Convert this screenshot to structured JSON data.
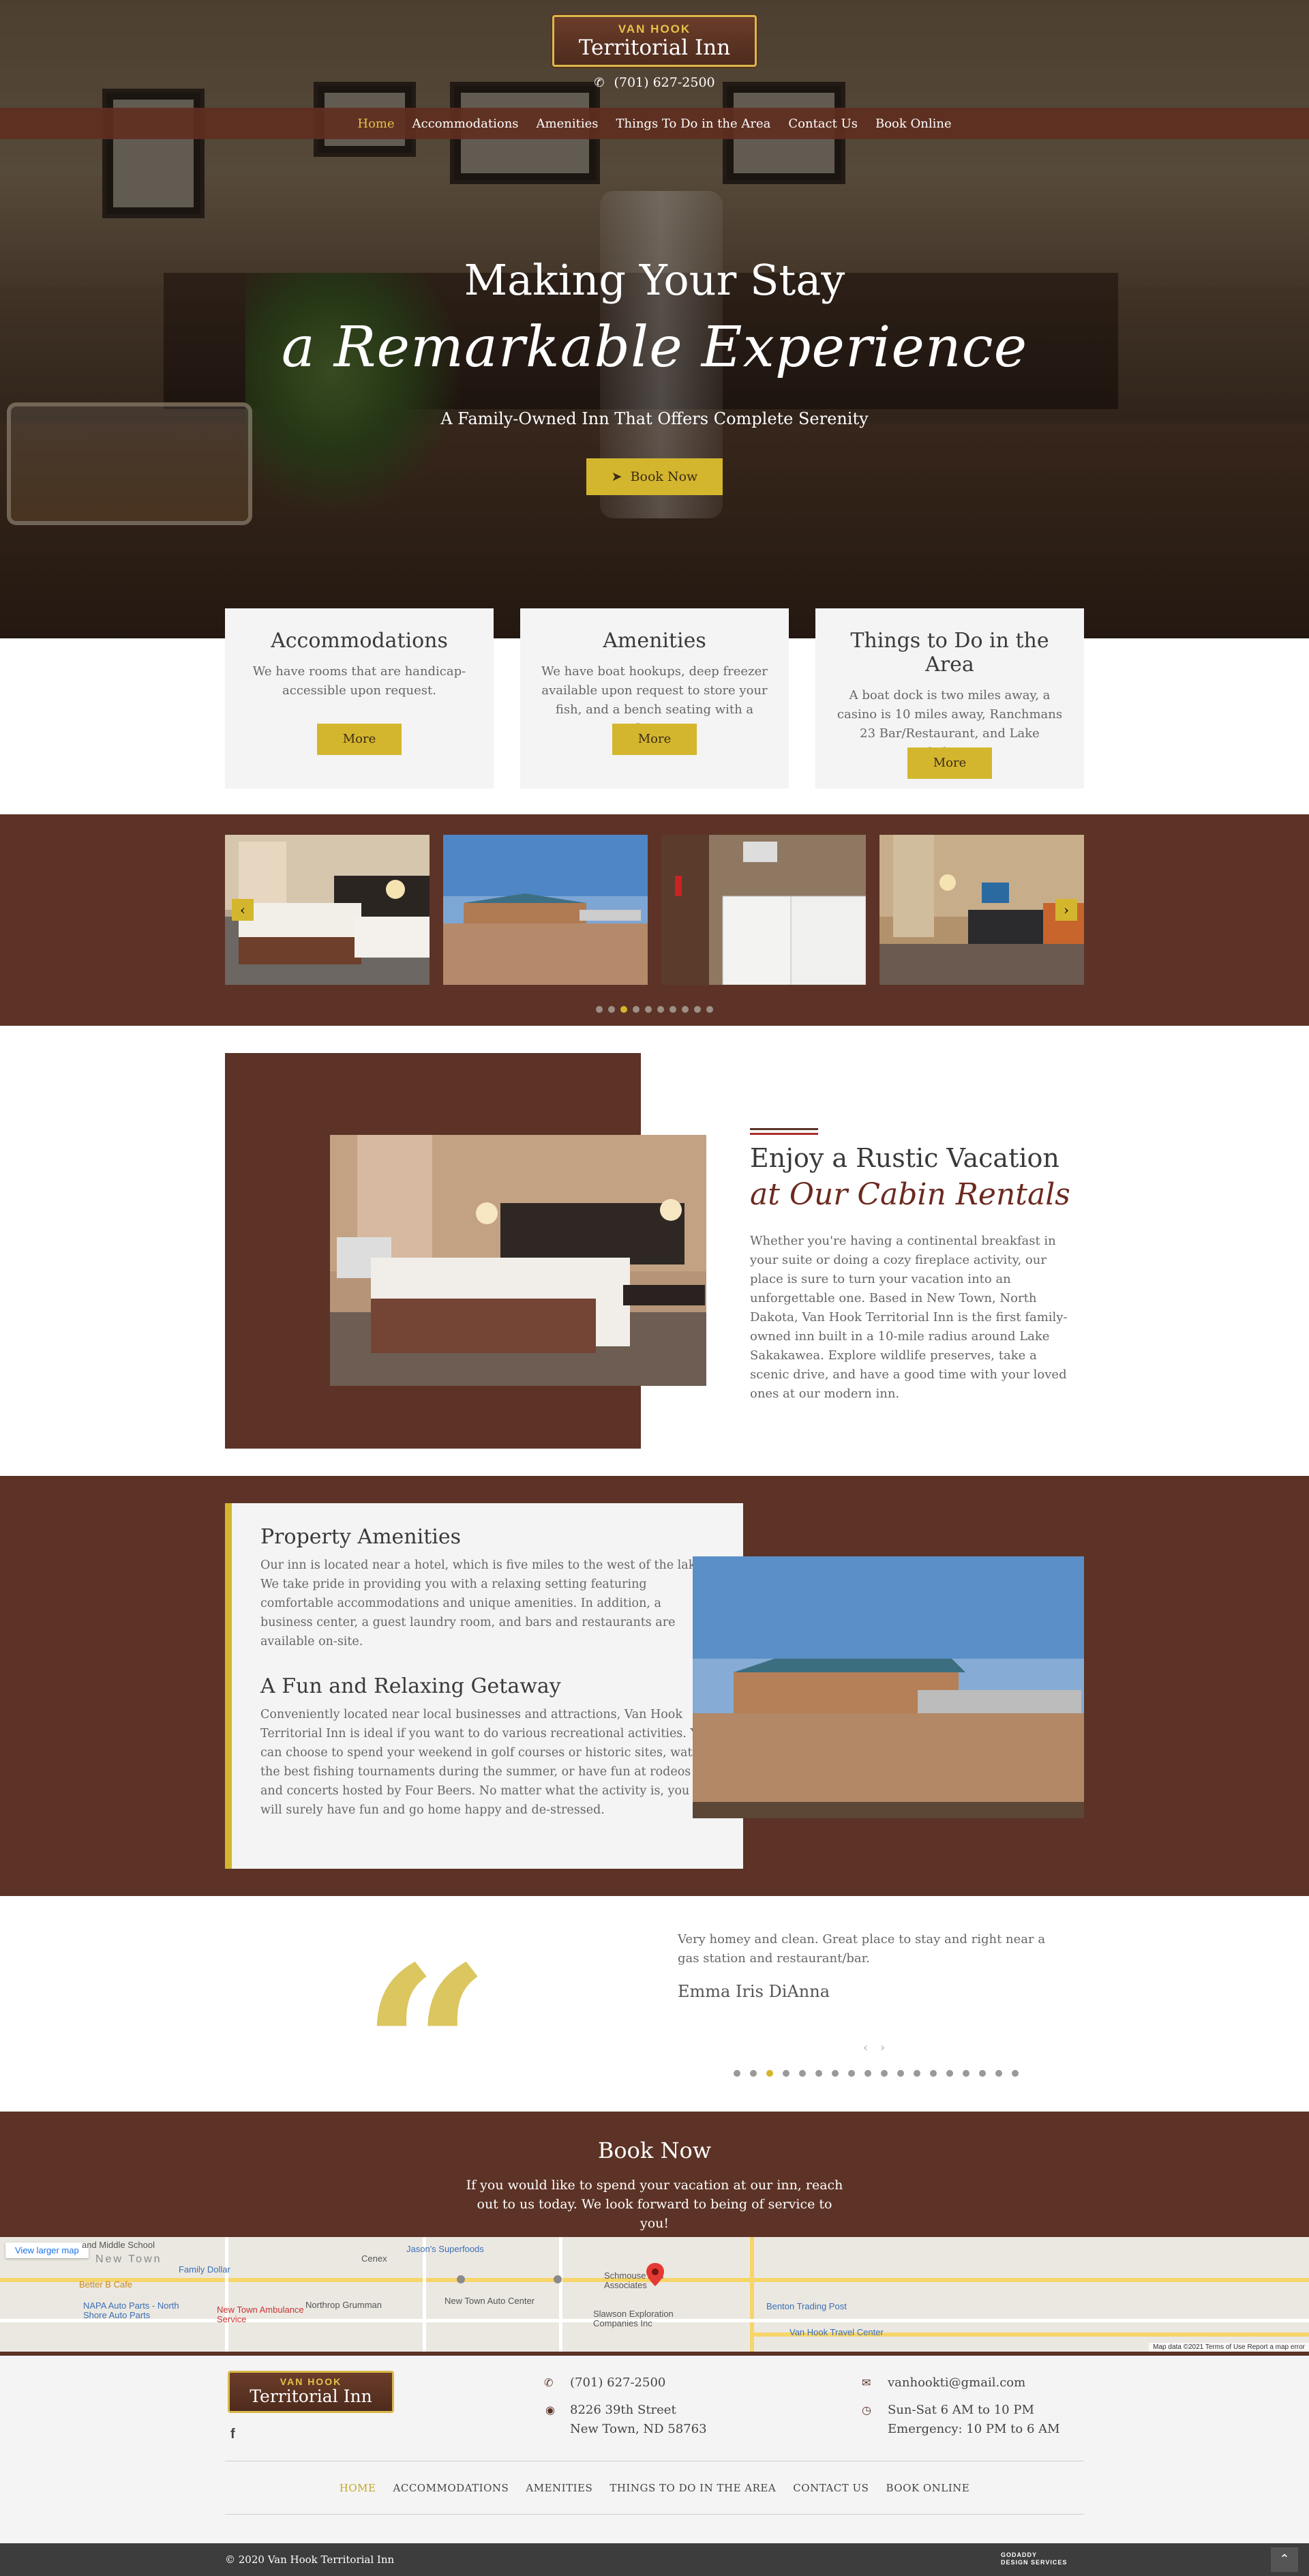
{
  "header": {
    "logo_small": "VAN HOOK",
    "logo_big": "Territorial Inn",
    "phone": "(701) 627-2500"
  },
  "nav": {
    "items": [
      "Home",
      "Accommodations",
      "Amenities",
      "Things To Do in the Area",
      "Contact Us",
      "Book Online"
    ],
    "active_index": 0
  },
  "hero": {
    "title_line1": "Making Your Stay",
    "title_line2": "a Remarkable Experience",
    "subtitle": "A Family-Owned Inn That Offers Complete Serenity",
    "button_label": "Book Now"
  },
  "cards": [
    {
      "title": "Accommodations",
      "text": "We have rooms that are handicap-accessible upon request.",
      "button": "More"
    },
    {
      "title": "Amenities",
      "text": "We have boat hookups, deep freezer available upon request to store your fish, and a bench seating with a firepit.",
      "button": "More"
    },
    {
      "title": "Things to Do in the Area",
      "text": "A boat dock is two miles away, a casino is 10 miles away, Ranchmans 23 Bar/Restaurant, and Lake Sakakawea.",
      "button": "More"
    }
  ],
  "gallery": {
    "prev_icon": "chevron-left-icon",
    "next_icon": "chevron-right-icon",
    "dot_count": 10,
    "active_dot": 2
  },
  "enjoy": {
    "title": "Enjoy a Rustic Vacation",
    "subtitle": "at Our Cabin Rentals",
    "text": "Whether you're having a continental breakfast in your suite or doing a cozy fireplace activity, our place is sure to turn your vacation into an unforgettable one. Based in New Town, North Dakota, Van Hook Territorial Inn is the first family-owned inn built in a 10-mile radius around Lake Sakakawea. Explore wildlife preserves, take a scenic drive, and have a good time with your loved ones at our modern inn."
  },
  "amenities": {
    "title1": "Property Amenities",
    "text1": "Our inn is located near a hotel, which is five miles to the west of the lake. We take pride in providing you with a relaxing setting featuring comfortable accommodations and unique amenities. In addition, a business center, a guest laundry room, and bars and restaurants are available on-site.",
    "title2": "A Fun and Relaxing Getaway",
    "text2": "Conveniently located near local businesses and attractions, Van Hook Territorial Inn is ideal if you want to do various recreational activities. You can choose to spend your weekend in golf courses or historic sites, watch the best fishing tournaments during the summer, or have fun at rodeos and concerts hosted by Four Beers. No matter what the activity is, you will surely have fun and go home happy and de-stressed."
  },
  "testimonial": {
    "quote": "Very homey and clean. Great place to stay and right near a gas station and restaurant/bar.",
    "author": "Emma Iris DiAnna",
    "prev": "‹",
    "next": "›",
    "dot_count": 18,
    "active_dot": 2
  },
  "book": {
    "title": "Book Now",
    "text": "If you would like to spend your vacation at our inn, reach out to us today. We look forward to being of service to you!"
  },
  "map": {
    "view_larger": "View larger map",
    "labels": [
      "Jason's Superfoods",
      "Cenex",
      "Family Dollar",
      "Better B Cafe",
      "NAPA Auto Parts - North Shore Auto Parts",
      "New Town Ambulance Service",
      "Northrop Grumman",
      "New Town Auto Center",
      "Schmouse And Associates",
      "Slawson Exploration Companies Inc",
      "Benton Trading Post",
      "Van Hook Travel Center",
      "New Town",
      "and Middle School"
    ],
    "attribution": "Map data ©2021   Terms of Use   Report a map error"
  },
  "footer": {
    "logo_small": "VAN HOOK",
    "logo_big": "Territorial Inn",
    "facebook": "f",
    "phone": "(701) 627-2500",
    "address_line1": "8226 39th Street",
    "address_line2": "New Town, ND 58763",
    "email": "vanhookti@gmail.com",
    "hours_line1": "Sun-Sat 6 AM to 10 PM",
    "hours_line2": "Emergency: 10 PM to 6 AM",
    "nav": [
      "HOME",
      "ACCOMMODATIONS",
      "AMENITIES",
      "THINGS TO DO IN THE AREA",
      "CONTACT US",
      "BOOK ONLINE"
    ],
    "copyright": "© 2020 Van Hook Territorial Inn",
    "badge_line1": "GODADDY",
    "badge_line2": "DESIGN SERVICES"
  },
  "colors": {
    "brown": "#5c3326",
    "gold": "#d3b62e",
    "card_bg": "#f4f4f4"
  }
}
